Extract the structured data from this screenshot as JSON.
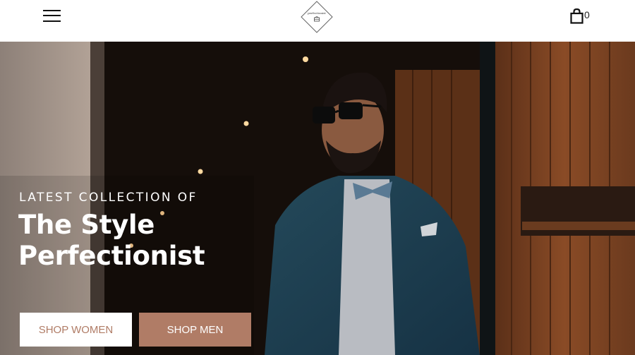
{
  "header": {
    "menu_icon": "hamburger-menu-icon",
    "logo_icon": "diamond-logo-icon",
    "logo_text": "perfectionist",
    "cart_icon": "shopping-bag-icon",
    "cart_count": "0"
  },
  "hero": {
    "kicker": "LATEST COLLECTION OF",
    "title_line1": "The Style",
    "title_line2": "Perfectionist",
    "buttons": {
      "women": "SHOP WOMEN",
      "men": "SHOP MEN"
    },
    "photo_description_icon": "hero-photo"
  },
  "colors": {
    "accent": "#b07c66",
    "header_bg": "#ffffff",
    "text_light": "#ffffff"
  }
}
